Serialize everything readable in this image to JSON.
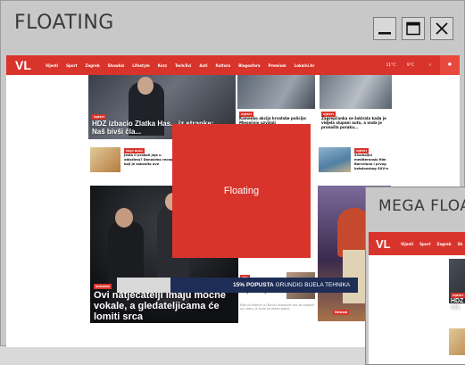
{
  "window": {
    "title": "FLOATING",
    "buttons": {
      "minimize": "minimize-icon",
      "maximize": "maximize-icon",
      "close": "close-icon"
    }
  },
  "site": {
    "logo": "VL",
    "nav": [
      "Vijesti",
      "Sport",
      "Zagreb",
      "Showbiz",
      "Lifestyle",
      "Kozz",
      "Tech/Sci",
      "Auti",
      "Kultura",
      "Blogosfera",
      "Premium",
      "Lokalni.hr"
    ],
    "right": {
      "weather": "11°C",
      "temp2": "9°C"
    }
  },
  "articles": {
    "main_headline": "HDZ izbacio Zlatka Has... iz stranke: Naš bivši čla...",
    "main_tag": "VIJESTI",
    "item2_tag": "VIJESTI",
    "item2_text": "Kamenko akcija hrvatske policije: Mjesečnjo uzvišali",
    "item3_tag": "VIJESTI",
    "item3_text": "Zagrepčanka se šokirala kada je vidjela slupani auto, a onda je pronašla poruku...",
    "item4_tag": "MAJA BLOG",
    "item4_text": "Jesta li probali jaja u obiačimu? Donosimo recept koji je zakonito ove",
    "item5_tag": "VIJESTI",
    "item5_text": "Sivoboljni mediteranski film Barcelona i prvog katalonskog SUV-a",
    "big_headline": "Ovi natjecatelji imaju močne vokale, a gledateljicama će lomiti srca",
    "big_tag": "SHOWBIZ",
    "item6_tag": "STIL",
    "item6_text": "Zdravko Mamić: Koji se b... smijati, čovječe Božiji",
    "item6_meta": "Nije za Mamić iz Daniel Vrbaniće vez se pojavili na ulazu, a sude se jedan pohio",
    "side_tag": "Stream"
  },
  "floating_panel": {
    "label": "Floating",
    "color": "#d9342b"
  },
  "mega_window": {
    "title": "MEGA FLOATING",
    "logo": "VL",
    "nav": [
      "Vijesti",
      "Sport",
      "Zagreb",
      "Sh"
    ],
    "tag": "VIJESTI",
    "headline_partial": "HDZ iz sta"
  },
  "ad": {
    "text_bold": "15% POPUSTA",
    "text_rest": "GRUNDIG BIJELA TEHNIKA"
  },
  "colors": {
    "accent": "#d9342b",
    "window_bg": "#c8c8c8"
  }
}
